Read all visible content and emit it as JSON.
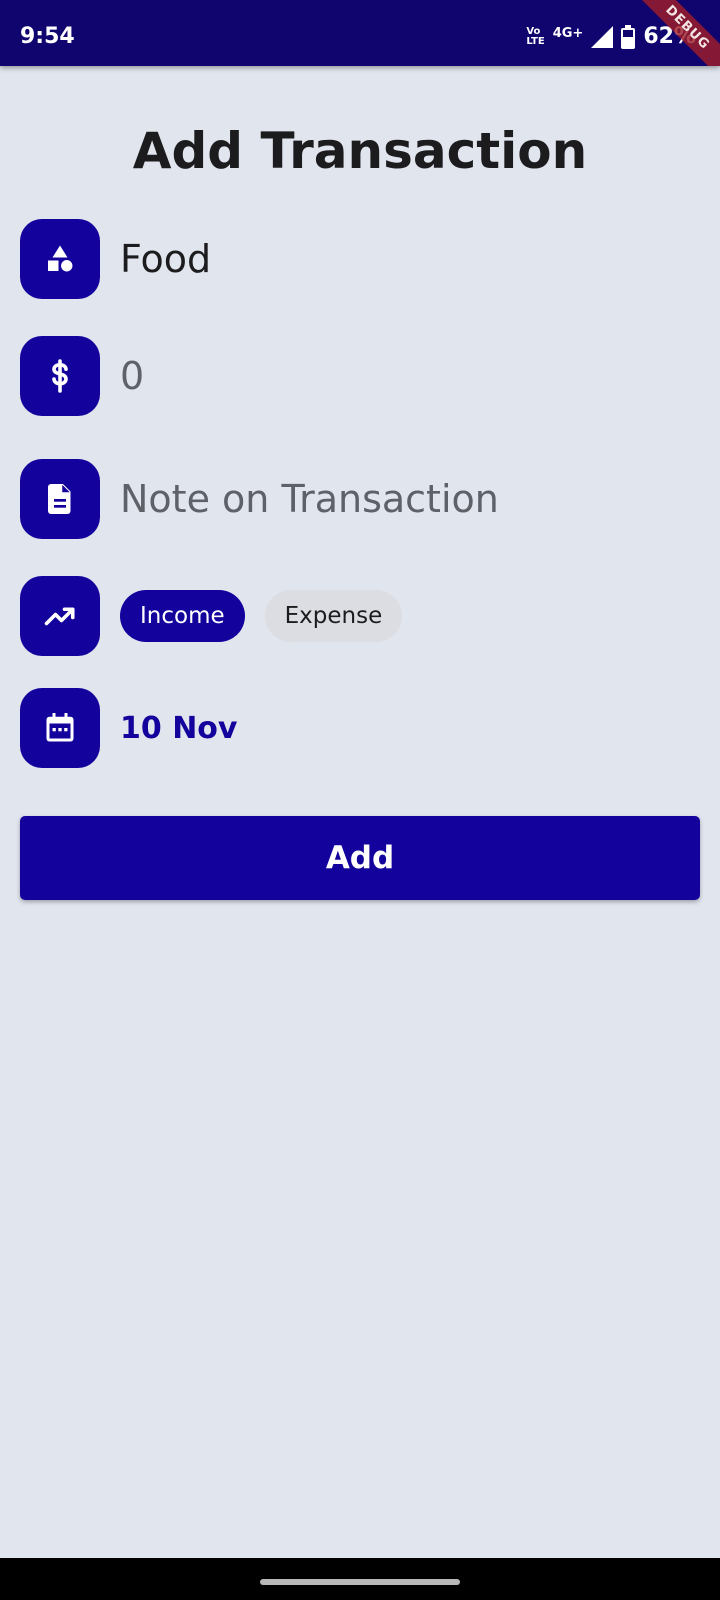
{
  "status_bar": {
    "time": "9:54",
    "volte_top": "Vo",
    "volte_bottom": "LTE",
    "network": "4G+",
    "battery": "62%",
    "debug_banner": "DEBUG"
  },
  "page": {
    "title": "Add Transaction"
  },
  "form": {
    "category": {
      "icon": "category-shapes-icon",
      "value": "Food"
    },
    "amount": {
      "icon": "dollar-icon",
      "placeholder": "0"
    },
    "note": {
      "icon": "document-icon",
      "placeholder": "Note on Transaction"
    },
    "type": {
      "icon": "trending-up-icon",
      "options": [
        "Income",
        "Expense"
      ],
      "selected": "Income"
    },
    "date": {
      "icon": "calendar-icon",
      "value": "10 Nov"
    },
    "submit_label": "Add"
  },
  "colors": {
    "primary": "#14029c",
    "status_bar": "#10056f",
    "background": "#e1e5ee",
    "chip_unselected": "#dcdde2"
  }
}
